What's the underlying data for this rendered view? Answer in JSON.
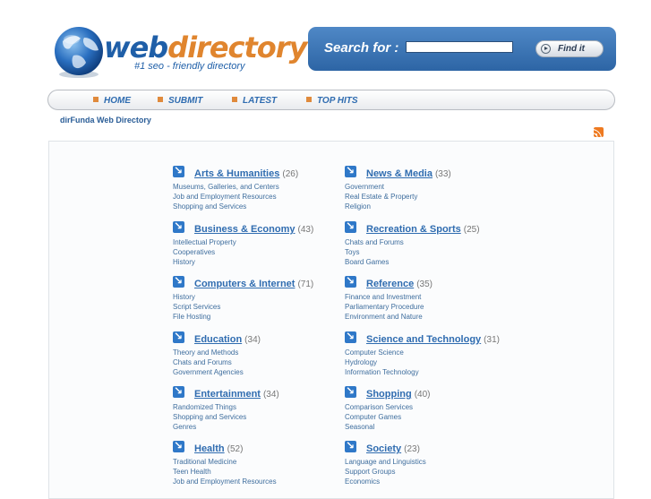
{
  "header": {
    "logo_prefix": "web",
    "logo_suffix": "directory",
    "tagline": "#1 seo - friendly directory"
  },
  "search": {
    "label": "Search for :",
    "value": "",
    "placeholder": "",
    "button_label": "Find it"
  },
  "nav": {
    "items": [
      {
        "label": "HOME"
      },
      {
        "label": "SUBMIT"
      },
      {
        "label": "LATEST"
      },
      {
        "label": "TOP HITS"
      }
    ]
  },
  "site_link": "dirFunda Web Directory",
  "colors": {
    "accent": "#2f6cb0",
    "orange": "#e08a3c",
    "search_bg": "#3a74b6"
  },
  "categories": [
    {
      "title": "Arts & Humanities",
      "count": "(26)",
      "subs": [
        "Museums, Galleries, and Centers",
        "Job and Employment Resources",
        "Shopping and Services"
      ]
    },
    {
      "title": "News & Media",
      "count": "(33)",
      "subs": [
        "Government",
        "Real Estate & Property",
        "Religion"
      ]
    },
    {
      "title": "Business & Economy",
      "count": "(43)",
      "subs": [
        "Intellectual Property",
        "Cooperatives",
        "History"
      ]
    },
    {
      "title": "Recreation & Sports",
      "count": "(25)",
      "subs": [
        "Chats and Forums",
        "Toys",
        "Board Games"
      ]
    },
    {
      "title": "Computers & Internet",
      "count": "(71)",
      "subs": [
        "History",
        "Script Services",
        "File Hosting"
      ]
    },
    {
      "title": "Reference",
      "count": "(35)",
      "subs": [
        "Finance and Investment",
        "Parliamentary Procedure",
        "Environment and Nature"
      ]
    },
    {
      "title": "Education",
      "count": "(34)",
      "subs": [
        "Theory and Methods",
        "Chats and Forums",
        "Government Agencies"
      ]
    },
    {
      "title": "Science and Technology",
      "count": "(31)",
      "subs": [
        "Computer Science",
        "Hydrology",
        "Information Technology"
      ]
    },
    {
      "title": "Entertainment",
      "count": "(34)",
      "subs": [
        "Randomized Things",
        "Shopping and Services",
        "Genres"
      ]
    },
    {
      "title": "Shopping",
      "count": "(40)",
      "subs": [
        "Comparison Services",
        "Computer Games",
        "Seasonal"
      ]
    },
    {
      "title": "Health",
      "count": "(52)",
      "subs": [
        "Traditional Medicine",
        "Teen Health",
        "Job and Employment Resources"
      ]
    },
    {
      "title": "Society",
      "count": "(23)",
      "subs": [
        "Language and Linguistics",
        "Support Groups",
        "Economics"
      ]
    }
  ]
}
